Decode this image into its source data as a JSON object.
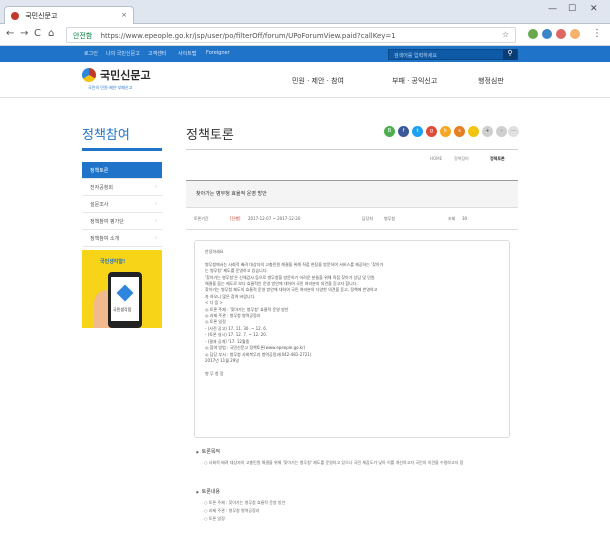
{
  "browser": {
    "tab_title": "국민신문고",
    "tab_close": "×",
    "win_min": "—",
    "win_max": "☐",
    "win_close": "✕",
    "back": "←",
    "forward": "→",
    "reload": "C",
    "home": "⌂",
    "secure_label": "안전함",
    "url": "https://www.epeople.go.kr/jsp/user/po/filterOff/forum/UPoForumView.paid?callKey=1",
    "star": "☆",
    "menu": "⋮"
  },
  "site_top": {
    "links": [
      "로그인",
      "나의 국민신문고",
      "고객센터",
      "사이트맵",
      "Foreigner"
    ],
    "search_placeholder": "검색어를 입력하세요",
    "search_icon": "search-icon"
  },
  "header": {
    "logo": "국민신문고",
    "logo_sub": "국민의 민원·제안·부패신고",
    "nav": [
      "민원 · 제안 · 참여",
      "부패 · 공익신고",
      "행정심판"
    ]
  },
  "lnb": {
    "title": "정책참여",
    "items": [
      "정책토론",
      "전자공청회",
      "설문조사",
      "정책참여 평가단",
      "정책참여 소개"
    ],
    "banner_text": "국민생각함!",
    "banner_phone_label": "국민생각함"
  },
  "content": {
    "title": "정책토론",
    "share": [
      "B",
      "f",
      "t",
      "g",
      "k",
      "s",
      "·",
      "+",
      "-",
      "···"
    ],
    "breadcrumb": [
      "HOME",
      "정책참여",
      "정책토론"
    ],
    "subject": "찾아가는 병무청 효율적 운영 방안",
    "meta": {
      "period_label": "토론기간",
      "status": "[진행]",
      "period": "2017-12-07 ~ 2017-12-20",
      "org_label": "담당처",
      "org": "병무청",
      "views_label": "조회",
      "views": "30"
    },
    "body_lines": [
      "안녕하세요",
      "",
      "병무청에서는 사회적 배려 대상자의 고충민원 해결을 위해 직접 현장을 방문하여 서비스를 제공하는 '찾아가",
      "는 병무청' 제도를 운영하고 있습니다.",
      "  '찾아가는 병무청'은 신체검사 등으로 병무청을 방문하기 어려운 분들을 위해 직접 찾아가 상담 및 민원",
      "해결을 돕는 제도로 보다 효율적인 운영 방안에 대하여 국민 여러분의 의견을 듣고자 합니다.",
      "  찾아가는 병무청 제도의 효율적 운영 방안에 대하여 국민 여러분의 다양한 의견을 듣고, 정책에 반영하고",
      "자 하오니 많은 참여 바랍니다.",
      "< 다   음 >",
      "  ◎ 토론 주제 : '찾아가는 병무청' 효율적 운영 방안",
      "  ◎ 과제 주관 : 병무청 병역공정과",
      "  ◎ 토론 일정",
      "      - (사전 공고) 17. 11. 30. ~ 12. 6.",
      "      - (토론 실시) 17. 12. 7. ~ 12. 20.",
      "      - (결과 공개) '17. 12월중",
      "  ◎ 참여 방법 : 국민신문고 정책토론(www.epeople.go.kr)",
      "  ◎ 담당 부서 : 병무청 사회복무과 병역공정과(042-481-2721)",
      "                                    2017년  11월 29일",
      "",
      "                     병   무   청   장"
    ],
    "section1_title": "토론목적",
    "section1_text": "○ 사회적 배려 대상자의 고충민원 해결을 위해 '찾아가는 병무청' 제도를 운영하고 있으나 국민 체감도가 낮아 이를 개선하고자 국민의 의견을 수렴하고자 함",
    "section2_title": "토론내용",
    "section2_lines": [
      "○ 토론 주제 : 찾아가는 병무청 효율적 운영 방안",
      "○ 과제 주관 : 병무청 병역공정과",
      "○ 토론 일정"
    ]
  },
  "colors": {
    "brand_blue": "#1f73c9",
    "banner_yellow": "#f7d417",
    "status_red": "#c0392b"
  }
}
